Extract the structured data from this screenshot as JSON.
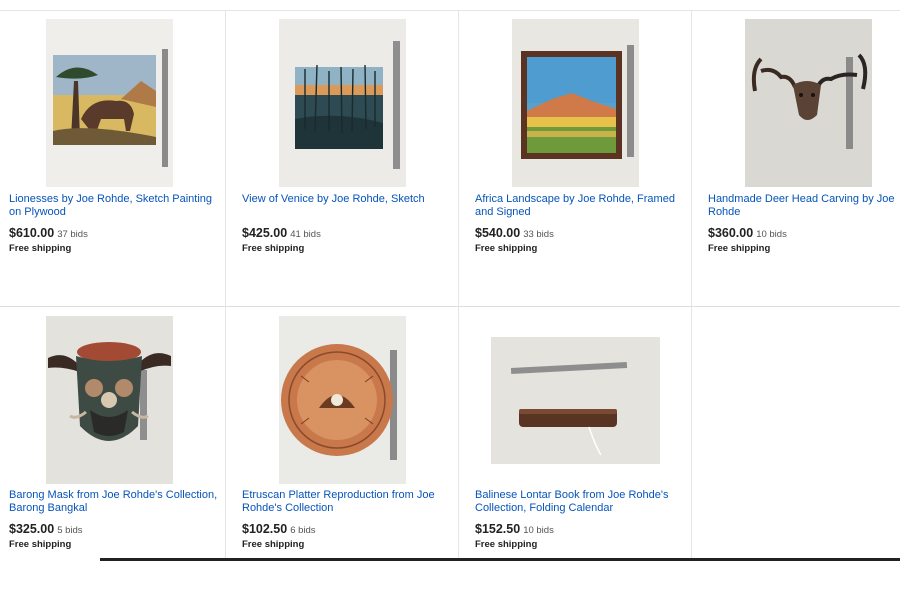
{
  "listings": [
    {
      "title": "Lionesses by Joe Rohde, Sketch Painting on Plywood",
      "price": "$610.00",
      "bids": "37 bids",
      "shipping": "Free shipping"
    },
    {
      "title": "View of Venice by Joe Rohde, Sketch",
      "price": "$425.00",
      "bids": "41 bids",
      "shipping": "Free shipping"
    },
    {
      "title": "Africa Landscape by Joe Rohde, Framed and Signed",
      "price": "$540.00",
      "bids": "33 bids",
      "shipping": "Free shipping"
    },
    {
      "title": "Handmade Deer Head Carving by Joe Rohde",
      "price": "$360.00",
      "bids": "10 bids",
      "shipping": "Free shipping"
    },
    {
      "title": "Barong Mask from Joe Rohde's Collection, Barong Bangkal",
      "price": "$325.00",
      "bids": "5 bids",
      "shipping": "Free shipping"
    },
    {
      "title": "Etruscan Platter Reproduction from Joe Rohde's Collection",
      "price": "$102.50",
      "bids": "6 bids",
      "shipping": "Free shipping"
    },
    {
      "title": "Balinese Lontar Book from Joe Rohde's Collection, Folding Calendar",
      "price": "$152.50",
      "bids": "10 bids",
      "shipping": "Free shipping"
    }
  ]
}
